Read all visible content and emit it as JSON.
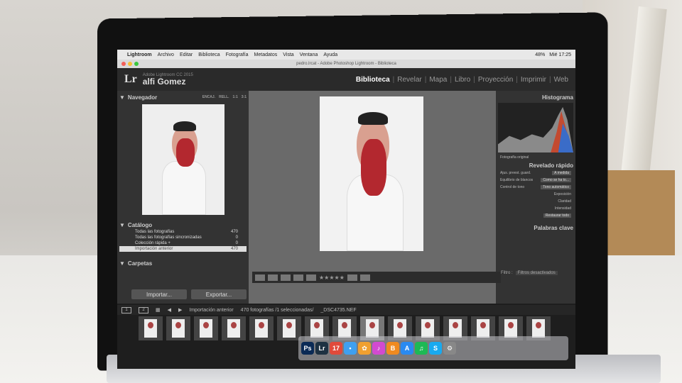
{
  "menubar": {
    "app": "Lightroom",
    "items": [
      "Archivo",
      "Editar",
      "Biblioteca",
      "Fotografía",
      "Metadatos",
      "Vista",
      "Ventana",
      "Ayuda"
    ],
    "right": [
      "48%",
      "Mié 17:25"
    ]
  },
  "window": {
    "title": "pedro.lrcat - Adobe Photoshop Lightroom - Biblioteca"
  },
  "identity": {
    "logo": "Lr",
    "app_version": "Adobe Lightroom CC 2015",
    "user": "alfi Gomez"
  },
  "modules": [
    "Biblioteca",
    "Revelar",
    "Mapa",
    "Libro",
    "Proyección",
    "Imprimir",
    "Web"
  ],
  "navigator": {
    "title": "Navegador",
    "options": [
      "ENCAJ.",
      "RELL.",
      "1:1",
      "3:1"
    ]
  },
  "catalog": {
    "title": "Catálogo",
    "rows": [
      {
        "label": "Todas las fotografías",
        "count": "470"
      },
      {
        "label": "Todas las fotografías sincronizadas",
        "count": "0"
      },
      {
        "label": "Colección rápida +",
        "count": "0"
      },
      {
        "label": "Importación anterior",
        "count": "470"
      }
    ]
  },
  "folders": {
    "title": "Carpetas"
  },
  "buttons": {
    "import": "Importar...",
    "export": "Exportar..."
  },
  "right_panel": {
    "histogram_title": "Histograma",
    "original": "Fotografía original",
    "quick_develop": "Revelado rápido",
    "rows": [
      {
        "label": "Ajus. preest. guard.",
        "value": "A medida"
      },
      {
        "label": "Equilibrio de blancos",
        "value": "Como se ha to..."
      },
      {
        "label": "Control de tono",
        "value": "Tono automático"
      }
    ],
    "subrows": [
      "Exposición",
      "Claridad",
      "Intensidad"
    ],
    "reset": "Restaurar todo",
    "keywords": "Palabras clave"
  },
  "filter": {
    "label": "Filtro :",
    "value": "Filtros desactivados"
  },
  "strip": {
    "source": "Importación anterior",
    "count": "470 fotografías /1 seleccionadas/",
    "file": "_DSC4735.NEF"
  },
  "dock": [
    {
      "name": "ps-icon",
      "label": "Ps",
      "color": "#0a2a55"
    },
    {
      "name": "lr-icon",
      "label": "Lr",
      "color": "#1d3142"
    },
    {
      "name": "calendar-icon",
      "label": "17",
      "color": "#e04a3a"
    },
    {
      "name": "messages-icon",
      "label": "•",
      "color": "#3fa0f0"
    },
    {
      "name": "photos-icon",
      "label": "✿",
      "color": "#f0a030"
    },
    {
      "name": "itunes-icon",
      "label": "♪",
      "color": "#d24ad0"
    },
    {
      "name": "books-icon",
      "label": "B",
      "color": "#f08a20"
    },
    {
      "name": "appstore-icon",
      "label": "A",
      "color": "#2a8af0"
    },
    {
      "name": "spotify-icon",
      "label": "♫",
      "color": "#1db954"
    },
    {
      "name": "skype-icon",
      "label": "S",
      "color": "#18aaf0"
    },
    {
      "name": "settings-icon",
      "label": "⚙",
      "color": "#888888"
    }
  ]
}
